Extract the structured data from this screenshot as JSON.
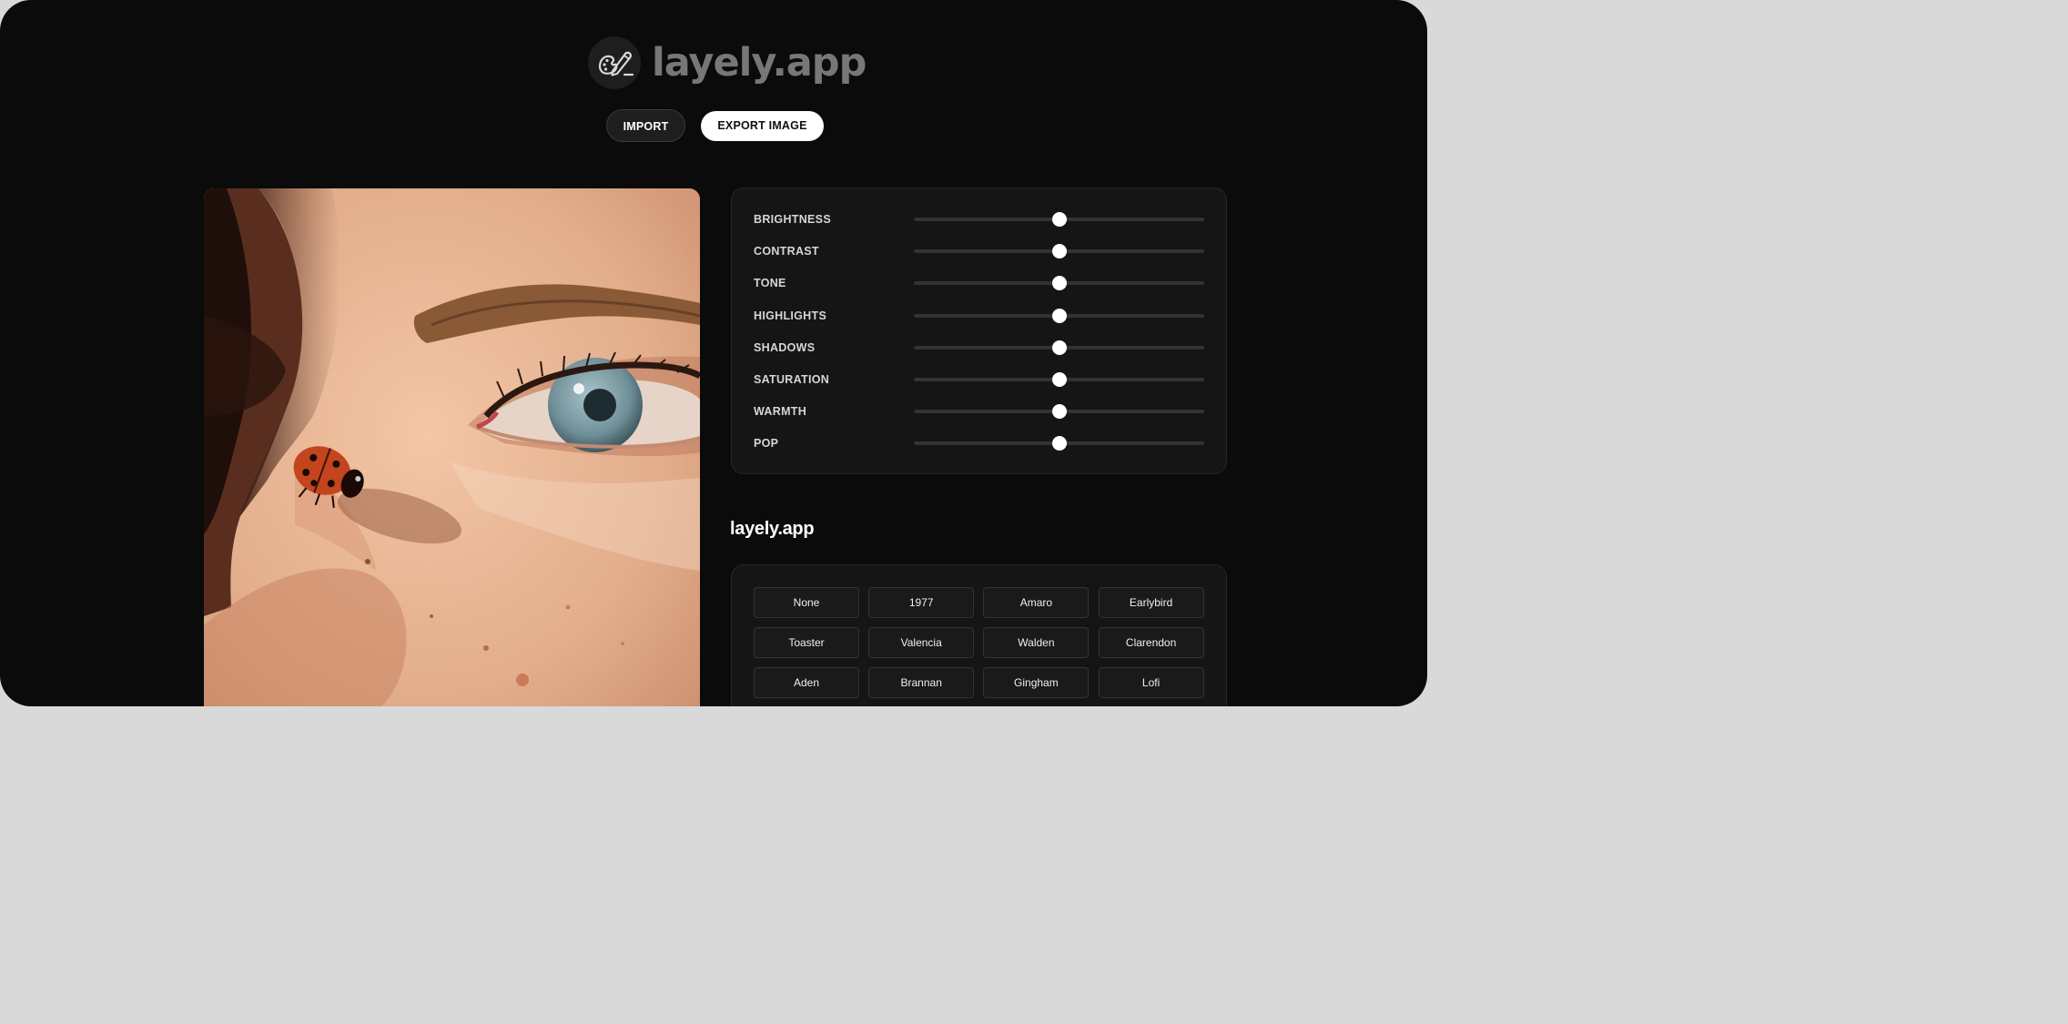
{
  "app": {
    "title": "layely.app",
    "logo_icon": "palette-pencil-icon"
  },
  "toolbar": {
    "import_label": "IMPORT",
    "export_label": "EXPORT IMAGE"
  },
  "photo": {
    "subject": "face-with-ladybug-photo"
  },
  "adjustments": [
    {
      "label": "BRIGHTNESS",
      "value": 0.5
    },
    {
      "label": "CONTRAST",
      "value": 0.5
    },
    {
      "label": "TONE",
      "value": 0.5
    },
    {
      "label": "HIGHLIGHTS",
      "value": 0.5
    },
    {
      "label": "SHADOWS",
      "value": 0.5
    },
    {
      "label": "SATURATION",
      "value": 0.5
    },
    {
      "label": "WARMTH",
      "value": 0.5
    },
    {
      "label": "POP",
      "value": 0.5
    }
  ],
  "filters": {
    "title": "layely.app",
    "items": [
      "None",
      "1977",
      "Amaro",
      "Earlybird",
      "Toaster",
      "Valencia",
      "Walden",
      "Clarendon",
      "Aden",
      "Brannan",
      "Gingham",
      "Lofi"
    ]
  },
  "colors": {
    "background": "#0b0b0b",
    "panel": "#151515",
    "accent": "#ffffff",
    "muted_title": "#777777"
  }
}
